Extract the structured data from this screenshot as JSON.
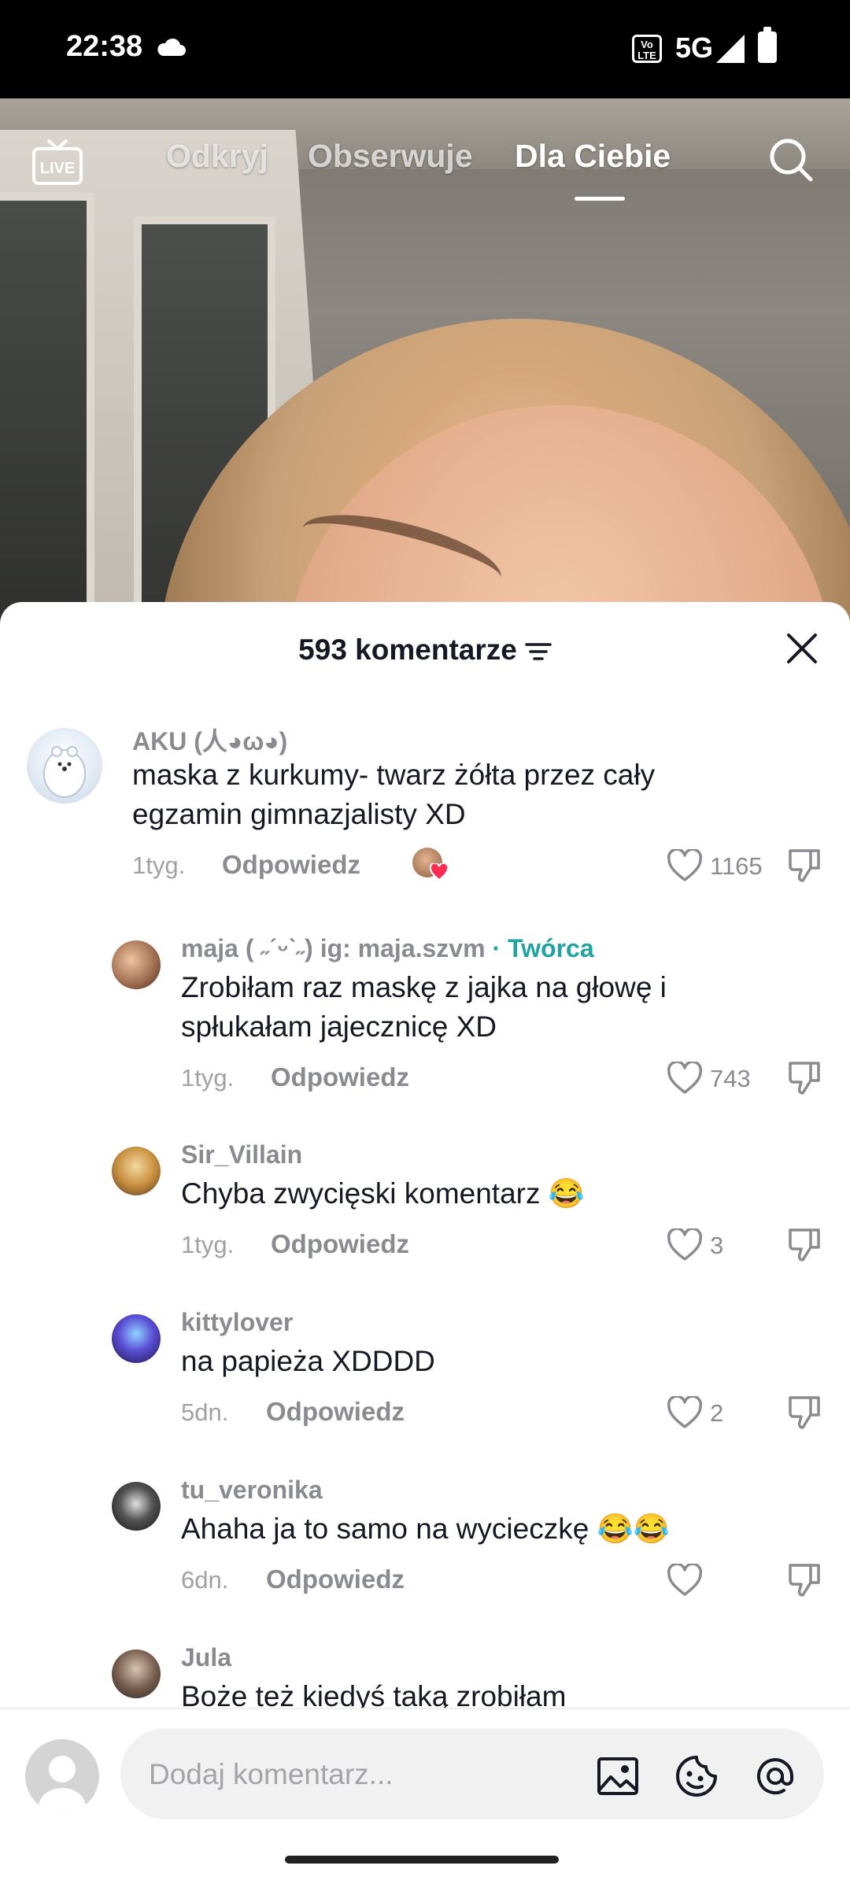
{
  "status_bar": {
    "time": "22:38",
    "volte": "Vo LTE",
    "network": "5G"
  },
  "top_nav": {
    "live_label": "LIVE",
    "tabs": [
      {
        "label": "Odkryj"
      },
      {
        "label": "Obserwuje"
      },
      {
        "label": "Dla Ciebie",
        "active": true
      }
    ]
  },
  "comments_sheet": {
    "title": "593 komentarze",
    "comments": [
      {
        "user": "AKU (人◕ω◕)",
        "text": "maska z kurkumy- twarz żółta przez cały egzamin gimnazjalisty XD",
        "time": "1tyg.",
        "reply_label": "Odpowiedz",
        "likes": "1165",
        "creator_liked": true
      },
      {
        "user": "maja ( ˶ˊᵕˋ˶) ig: maja.szvm",
        "creator_badge": "· Twórca",
        "text": "Zrobiłam raz maskę z jajka na głowę i spłukałam jajecznicę XD",
        "time": "1tyg.",
        "reply_label": "Odpowiedz",
        "likes": "743"
      },
      {
        "user": "Sir_Villain",
        "text": "Chyba zwycięski komentarz 😂",
        "time": "1tyg.",
        "reply_label": "Odpowiedz",
        "likes": "3"
      },
      {
        "user": "kittylover",
        "text": "na papieża XDDDD",
        "time": "5dn.",
        "reply_label": "Odpowiedz",
        "likes": "2"
      },
      {
        "user": "tu_veronika",
        "text": "Ahaha ja to samo na wycieczkę 😂😂",
        "time": "6dn.",
        "reply_label": "Odpowiedz",
        "likes": ""
      },
      {
        "user": "Jula",
        "text": "Boże też kiedyś taką zrobiłam"
      }
    ]
  },
  "input_bar": {
    "placeholder": "Dodaj komentarz..."
  },
  "colors": {
    "creator": "#20a3a3",
    "like_heart": "#fe2c55",
    "text": "#161823",
    "muted": "#8a8b91"
  }
}
